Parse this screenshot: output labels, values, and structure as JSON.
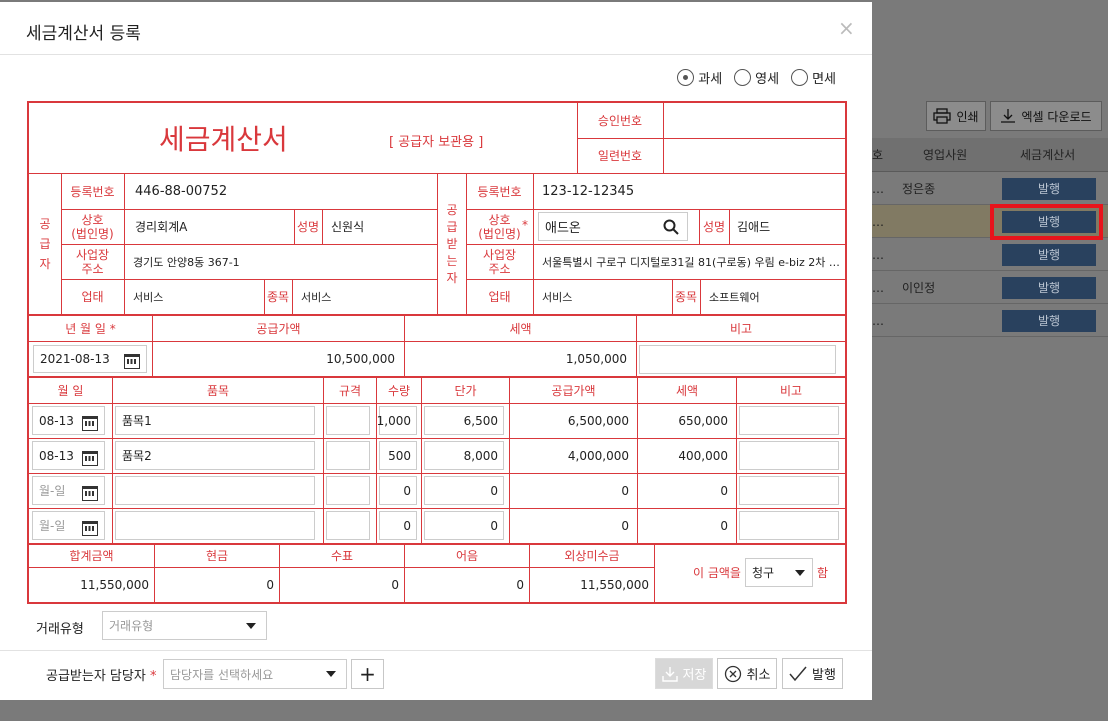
{
  "background": {
    "print_label": "인쇄",
    "excel_label": "엑셀 다운로드",
    "columns": [
      "호",
      "영업사원",
      "세금계산서"
    ],
    "rows": [
      {
        "col1": "…",
        "salesperson": "정은종",
        "action": "발행"
      },
      {
        "col1": "…",
        "salesperson": "",
        "action": "발행"
      },
      {
        "col1": "…",
        "salesperson": "",
        "action": "발행"
      },
      {
        "col1": "…",
        "salesperson": "이인정",
        "action": "발행"
      },
      {
        "col1": "…",
        "salesperson": "",
        "action": "발행"
      }
    ]
  },
  "modal": {
    "title": "세금계산서 등록",
    "close": "×",
    "tax_types": [
      {
        "label": "과세",
        "selected": true
      },
      {
        "label": "영세",
        "selected": false
      },
      {
        "label": "면세",
        "selected": false
      }
    ]
  },
  "invoice": {
    "title": "세금계산서",
    "copy_label": "[ 공급자 보관용 ]",
    "approval_no_label": "승인번호",
    "serial_no_label": "일련번호",
    "supplier": {
      "side_label": "공급자",
      "reg_no_label": "등록번호",
      "reg_no": "446-88-00752",
      "company_label": "상호\n(법인명)",
      "company": "경리회계A",
      "name_label": "성명",
      "name": "신원식",
      "address_label": "사업장\n주소",
      "address": "경기도 안양8동 367-1",
      "business_label": "업태",
      "business": "서비스",
      "item_label": "종목",
      "item": "서비스"
    },
    "buyer": {
      "side_label": "공급받는자",
      "reg_no_label": "등록번호",
      "reg_no": "123-12-12345",
      "company_label": "상호\n(법인명)",
      "company": "애드온",
      "name_label": "성명",
      "name": "김애드",
      "address_label": "사업장\n주소",
      "address": "서울특별시 구로구 디지털로31길 81(구로동) 우림 e-biz 2차 …",
      "business_label": "업태",
      "business": "서비스",
      "item_label": "종목",
      "item": "소프트웨어"
    },
    "summary": {
      "date_label": "년 월 일",
      "supply_label": "공급가액",
      "tax_label": "세액",
      "note_label": "비고",
      "date": "2021-08-13",
      "supply": "10,500,000",
      "tax": "1,050,000",
      "note": ""
    },
    "item_headers": [
      "월 일",
      "품목",
      "규격",
      "수량",
      "단가",
      "공급가액",
      "세액",
      "비고"
    ],
    "items": [
      {
        "date": "08-13",
        "name": "품목1",
        "spec": "",
        "qty": "1,000",
        "price": "6,500",
        "supply": "6,500,000",
        "tax": "650,000",
        "note": ""
      },
      {
        "date": "08-13",
        "name": "품목2",
        "spec": "",
        "qty": "500",
        "price": "8,000",
        "supply": "4,000,000",
        "tax": "400,000",
        "note": ""
      },
      {
        "date": "월-일",
        "name": "",
        "spec": "",
        "qty": "0",
        "price": "0",
        "supply": "0",
        "tax": "0",
        "note": ""
      },
      {
        "date": "월-일",
        "name": "",
        "spec": "",
        "qty": "0",
        "price": "0",
        "supply": "0",
        "tax": "0",
        "note": ""
      }
    ],
    "totals": {
      "total_label": "합계금액",
      "cash_label": "현금",
      "check_label": "수표",
      "note_label": "어음",
      "credit_label": "외상미수금",
      "total": "11,550,000",
      "cash": "0",
      "check": "0",
      "note": "0",
      "credit": "11,550,000",
      "amount_prefix": "이 금액을",
      "amount_mode": "청구",
      "amount_suffix": "함"
    }
  },
  "footer": {
    "trade_type_label": "거래유형",
    "trade_type_placeholder": "거래유형",
    "manager_label": "공급받는자 담당자",
    "manager_placeholder": "담당자를 선택하세요",
    "add_symbol": "+",
    "save_label": "저장",
    "cancel_label": "취소",
    "issue_label": "발행"
  },
  "colors": {
    "accent": "#d9383c",
    "issue_button": "#29415e",
    "highlight": "#e8141b"
  }
}
